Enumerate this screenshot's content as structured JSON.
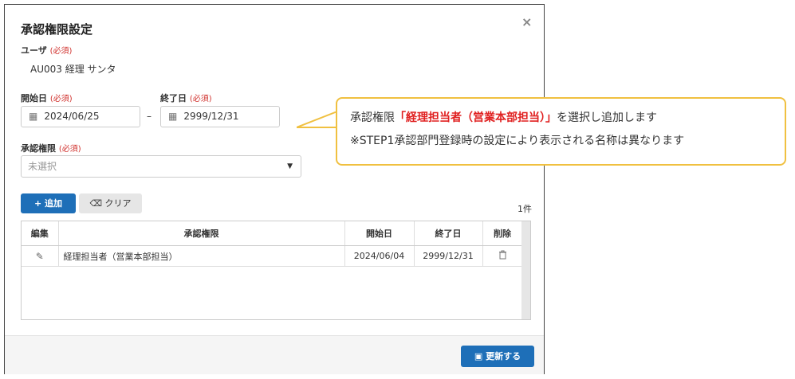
{
  "dialog": {
    "title": "承認権限設定",
    "close_glyph": "×",
    "user_label": "ユーザ",
    "user_value": "AU003 経理 サンタ",
    "required": "(必須)",
    "start_label": "開始日",
    "end_label": "終了日",
    "start_value": "2024/06/25",
    "end_value": "2999/12/31",
    "range_dash": "–",
    "authority_label": "承認権限",
    "authority_placeholder": "未選択",
    "add_button": "追加",
    "clear_button": "クリア",
    "count": "1件"
  },
  "table": {
    "headers": [
      "編集",
      "承認権限",
      "開始日",
      "終了日",
      "削除"
    ],
    "rows": [
      {
        "authority": "経理担当者（営業本部担当）",
        "start": "2024/06/04",
        "end": "2999/12/31"
      }
    ]
  },
  "footer": {
    "update_button": "更新する"
  },
  "callout": {
    "line1_prefix": "承認権限",
    "line1_highlight": "「経理担当者（営業本部担当）」",
    "line1_suffix": "を選択し追加します",
    "line2": "※STEP1承認部門登録時の設定により表示される名称は異なります"
  },
  "colors": {
    "primary": "#1e6fb8",
    "required": "#d0312d",
    "callout_border": "#f0c040",
    "highlight": "#e02020"
  }
}
